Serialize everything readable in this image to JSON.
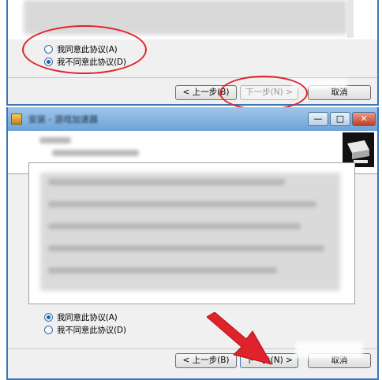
{
  "top_window": {
    "options": [
      {
        "label": "我同意此协议(A)",
        "selected": false
      },
      {
        "label": "我不同意此协议(D)",
        "selected": true
      }
    ],
    "buttons": {
      "back": "< 上一步(B)",
      "next": "下一步(N) >",
      "cancel": "取消"
    }
  },
  "bottom_window": {
    "title": "安装 - 游戏加速器",
    "caption_buttons": {
      "minimize": "—",
      "maximize": "□",
      "close": "✕"
    },
    "options": [
      {
        "label": "我同意此协议(A)",
        "selected": true
      },
      {
        "label": "我不同意此协议(D)",
        "selected": false
      }
    ],
    "buttons": {
      "back": "< 上一步(B)",
      "next": "下一步(N) >",
      "cancel": "取消"
    }
  },
  "colors": {
    "annotation": "#e0222a",
    "window_frame": "#3c76b6",
    "selected_radio": "#1d5fb8"
  },
  "icons": {
    "app": "installer-icon",
    "header": "computer-icon",
    "annotation": "arrow-icon"
  }
}
